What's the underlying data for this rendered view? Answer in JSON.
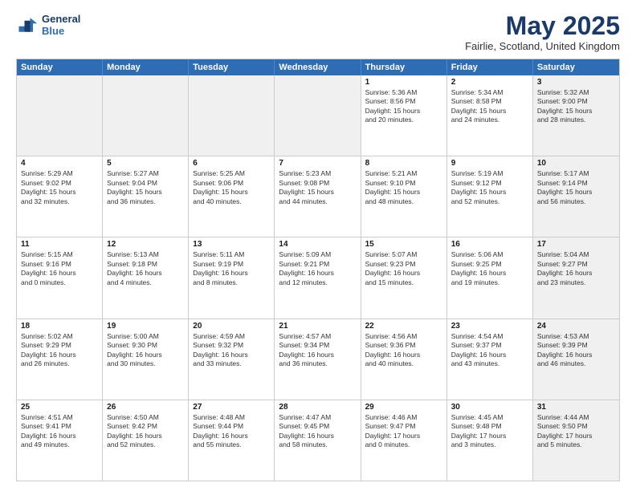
{
  "logo": {
    "line1": "General",
    "line2": "Blue"
  },
  "title": "May 2025",
  "location": "Fairlie, Scotland, United Kingdom",
  "days_of_week": [
    "Sunday",
    "Monday",
    "Tuesday",
    "Wednesday",
    "Thursday",
    "Friday",
    "Saturday"
  ],
  "weeks": [
    [
      {
        "day": "",
        "info": "",
        "shaded": true
      },
      {
        "day": "",
        "info": "",
        "shaded": true
      },
      {
        "day": "",
        "info": "",
        "shaded": true
      },
      {
        "day": "",
        "info": "",
        "shaded": true
      },
      {
        "day": "1",
        "info": "Sunrise: 5:36 AM\nSunset: 8:56 PM\nDaylight: 15 hours\nand 20 minutes.",
        "shaded": false
      },
      {
        "day": "2",
        "info": "Sunrise: 5:34 AM\nSunset: 8:58 PM\nDaylight: 15 hours\nand 24 minutes.",
        "shaded": false
      },
      {
        "day": "3",
        "info": "Sunrise: 5:32 AM\nSunset: 9:00 PM\nDaylight: 15 hours\nand 28 minutes.",
        "shaded": true
      }
    ],
    [
      {
        "day": "4",
        "info": "Sunrise: 5:29 AM\nSunset: 9:02 PM\nDaylight: 15 hours\nand 32 minutes.",
        "shaded": false
      },
      {
        "day": "5",
        "info": "Sunrise: 5:27 AM\nSunset: 9:04 PM\nDaylight: 15 hours\nand 36 minutes.",
        "shaded": false
      },
      {
        "day": "6",
        "info": "Sunrise: 5:25 AM\nSunset: 9:06 PM\nDaylight: 15 hours\nand 40 minutes.",
        "shaded": false
      },
      {
        "day": "7",
        "info": "Sunrise: 5:23 AM\nSunset: 9:08 PM\nDaylight: 15 hours\nand 44 minutes.",
        "shaded": false
      },
      {
        "day": "8",
        "info": "Sunrise: 5:21 AM\nSunset: 9:10 PM\nDaylight: 15 hours\nand 48 minutes.",
        "shaded": false
      },
      {
        "day": "9",
        "info": "Sunrise: 5:19 AM\nSunset: 9:12 PM\nDaylight: 15 hours\nand 52 minutes.",
        "shaded": false
      },
      {
        "day": "10",
        "info": "Sunrise: 5:17 AM\nSunset: 9:14 PM\nDaylight: 15 hours\nand 56 minutes.",
        "shaded": true
      }
    ],
    [
      {
        "day": "11",
        "info": "Sunrise: 5:15 AM\nSunset: 9:16 PM\nDaylight: 16 hours\nand 0 minutes.",
        "shaded": false
      },
      {
        "day": "12",
        "info": "Sunrise: 5:13 AM\nSunset: 9:18 PM\nDaylight: 16 hours\nand 4 minutes.",
        "shaded": false
      },
      {
        "day": "13",
        "info": "Sunrise: 5:11 AM\nSunset: 9:19 PM\nDaylight: 16 hours\nand 8 minutes.",
        "shaded": false
      },
      {
        "day": "14",
        "info": "Sunrise: 5:09 AM\nSunset: 9:21 PM\nDaylight: 16 hours\nand 12 minutes.",
        "shaded": false
      },
      {
        "day": "15",
        "info": "Sunrise: 5:07 AM\nSunset: 9:23 PM\nDaylight: 16 hours\nand 15 minutes.",
        "shaded": false
      },
      {
        "day": "16",
        "info": "Sunrise: 5:06 AM\nSunset: 9:25 PM\nDaylight: 16 hours\nand 19 minutes.",
        "shaded": false
      },
      {
        "day": "17",
        "info": "Sunrise: 5:04 AM\nSunset: 9:27 PM\nDaylight: 16 hours\nand 23 minutes.",
        "shaded": true
      }
    ],
    [
      {
        "day": "18",
        "info": "Sunrise: 5:02 AM\nSunset: 9:29 PM\nDaylight: 16 hours\nand 26 minutes.",
        "shaded": false
      },
      {
        "day": "19",
        "info": "Sunrise: 5:00 AM\nSunset: 9:30 PM\nDaylight: 16 hours\nand 30 minutes.",
        "shaded": false
      },
      {
        "day": "20",
        "info": "Sunrise: 4:59 AM\nSunset: 9:32 PM\nDaylight: 16 hours\nand 33 minutes.",
        "shaded": false
      },
      {
        "day": "21",
        "info": "Sunrise: 4:57 AM\nSunset: 9:34 PM\nDaylight: 16 hours\nand 36 minutes.",
        "shaded": false
      },
      {
        "day": "22",
        "info": "Sunrise: 4:56 AM\nSunset: 9:36 PM\nDaylight: 16 hours\nand 40 minutes.",
        "shaded": false
      },
      {
        "day": "23",
        "info": "Sunrise: 4:54 AM\nSunset: 9:37 PM\nDaylight: 16 hours\nand 43 minutes.",
        "shaded": false
      },
      {
        "day": "24",
        "info": "Sunrise: 4:53 AM\nSunset: 9:39 PM\nDaylight: 16 hours\nand 46 minutes.",
        "shaded": true
      }
    ],
    [
      {
        "day": "25",
        "info": "Sunrise: 4:51 AM\nSunset: 9:41 PM\nDaylight: 16 hours\nand 49 minutes.",
        "shaded": false
      },
      {
        "day": "26",
        "info": "Sunrise: 4:50 AM\nSunset: 9:42 PM\nDaylight: 16 hours\nand 52 minutes.",
        "shaded": false
      },
      {
        "day": "27",
        "info": "Sunrise: 4:48 AM\nSunset: 9:44 PM\nDaylight: 16 hours\nand 55 minutes.",
        "shaded": false
      },
      {
        "day": "28",
        "info": "Sunrise: 4:47 AM\nSunset: 9:45 PM\nDaylight: 16 hours\nand 58 minutes.",
        "shaded": false
      },
      {
        "day": "29",
        "info": "Sunrise: 4:46 AM\nSunset: 9:47 PM\nDaylight: 17 hours\nand 0 minutes.",
        "shaded": false
      },
      {
        "day": "30",
        "info": "Sunrise: 4:45 AM\nSunset: 9:48 PM\nDaylight: 17 hours\nand 3 minutes.",
        "shaded": false
      },
      {
        "day": "31",
        "info": "Sunrise: 4:44 AM\nSunset: 9:50 PM\nDaylight: 17 hours\nand 5 minutes.",
        "shaded": true
      }
    ]
  ]
}
